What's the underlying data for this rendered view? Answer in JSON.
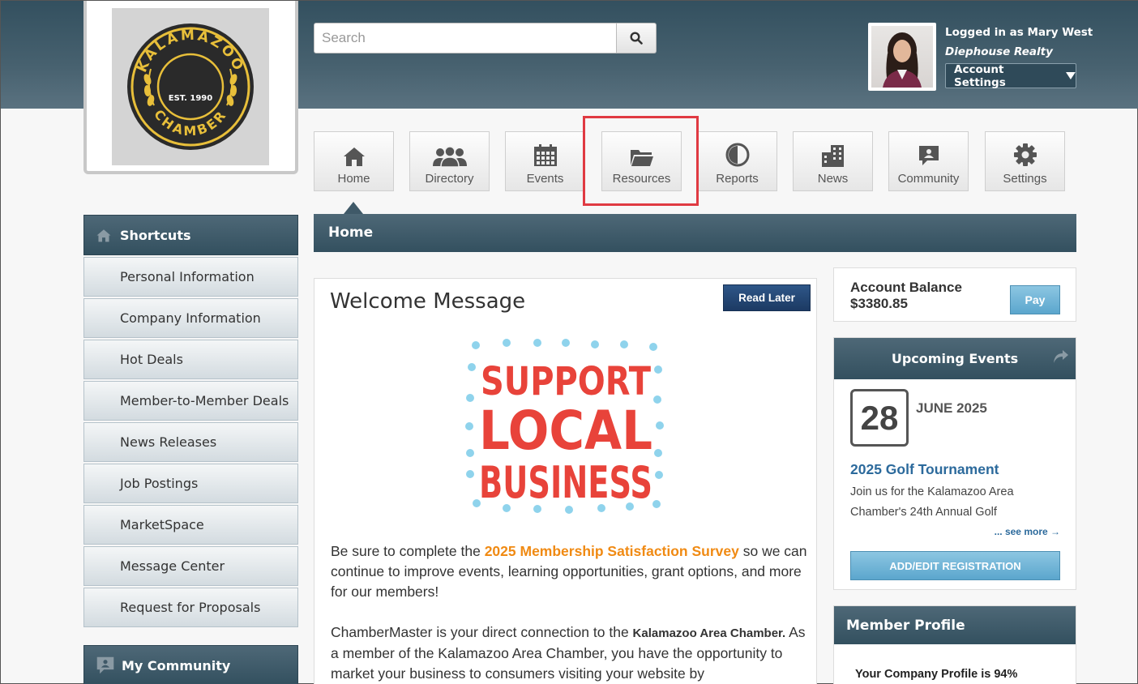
{
  "logo": {
    "top_text": "KALAMAZOO",
    "bottom_text": "CHAMBER",
    "est": "EST. 1990"
  },
  "search": {
    "placeholder": "Search"
  },
  "user": {
    "logged_in": "Logged in as Mary West",
    "company": "Diephouse Realty",
    "account_settings_label": "Account Settings"
  },
  "nav": {
    "items": [
      {
        "label": "Home",
        "icon": "home-icon"
      },
      {
        "label": "Directory",
        "icon": "people-icon"
      },
      {
        "label": "Events",
        "icon": "calendar-icon"
      },
      {
        "label": "Resources",
        "icon": "folder-icon"
      },
      {
        "label": "Reports",
        "icon": "pie-chart-icon"
      },
      {
        "label": "News",
        "icon": "building-icon"
      },
      {
        "label": "Community",
        "icon": "chat-icon"
      },
      {
        "label": "Settings",
        "icon": "gear-icon"
      }
    ]
  },
  "page": {
    "title": "Home"
  },
  "shortcuts": {
    "title": "Shortcuts",
    "items": [
      "Personal Information",
      "Company Information",
      "Hot Deals",
      "Member-to-Member Deals",
      "News Releases",
      "Job Postings",
      "MarketSpace",
      "Message Center",
      "Request for Proposals"
    ]
  },
  "my_community": {
    "title": "My Community"
  },
  "welcome": {
    "title": "Welcome Message",
    "read_later": "Read Later",
    "image_text": [
      "SUPPORT",
      "LOCAL",
      "BUSINESS"
    ],
    "p1_before": "Be sure to complete the ",
    "p1_link": "2025 Membership Satisfaction Survey",
    "p1_after": " so we can continue to improve events, learning opportunities, grant options, and more for our members!",
    "p2_before": "ChamberMaster is your direct connection to the ",
    "p2_bold": "Kalamazoo Area Chamber.",
    "p2_after": " As a member of the Kalamazoo Area Chamber, you have the opportunity to market your business to consumers visiting your website by"
  },
  "account": {
    "label": "Account Balance",
    "amount": "$3380.85",
    "pay": "Pay"
  },
  "events": {
    "title": "Upcoming Events",
    "day": "28",
    "month": "JUNE 2025",
    "event_title": "2025 Golf Tournament",
    "description": "Join us for the Kalamazoo Area Chamber's 24th Annual Golf",
    "see_more": "... see more →",
    "register": "ADD/EDIT REGISTRATION"
  },
  "profile": {
    "title": "Member Profile",
    "status": "Your Company Profile is 94%"
  },
  "colors": {
    "header": "#3f5968",
    "accent_orange": "#f08a13",
    "link_blue": "#2c6a9c",
    "highlight_red": "#e03a42"
  }
}
